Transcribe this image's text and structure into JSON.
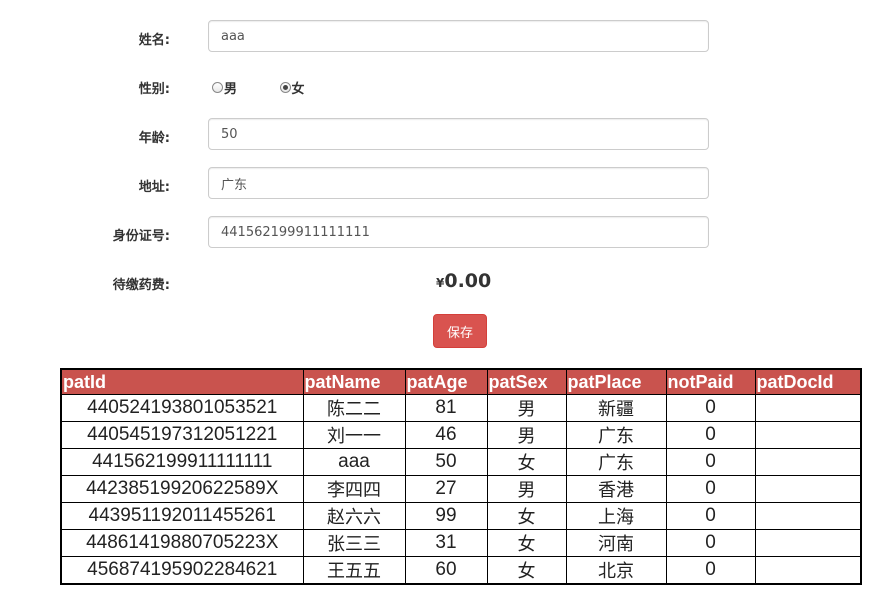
{
  "form": {
    "name_label": "姓名:",
    "name_value": "aaa",
    "sex_label": "性别:",
    "sex_options": [
      {
        "label": "男",
        "checked": false
      },
      {
        "label": "女",
        "checked": true
      }
    ],
    "age_label": "年龄:",
    "age_value": "50",
    "address_label": "地址:",
    "address_value": "广东",
    "idcard_label": "身份证号:",
    "idcard_value": "441562199911111111",
    "fee_label": "待缴药费:",
    "fee_currency": "¥",
    "fee_amount": "0.00",
    "save_label": "保存"
  },
  "table": {
    "header_color": "#c9534e",
    "columns": [
      "patId",
      "patName",
      "patAge",
      "patSex",
      "patPlace",
      "notPaid",
      "patDocId"
    ],
    "rows": [
      [
        "440524193801053521",
        "陈二二",
        "81",
        "男",
        "新疆",
        "0",
        ""
      ],
      [
        "440545197312051221",
        "刘一一",
        "46",
        "男",
        "广东",
        "0",
        ""
      ],
      [
        "441562199911111111",
        "aaa",
        "50",
        "女",
        "广东",
        "0",
        ""
      ],
      [
        "44238519920622589X",
        "李四四",
        "27",
        "男",
        "香港",
        "0",
        ""
      ],
      [
        "443951192011455261",
        "赵六六",
        "99",
        "女",
        "上海",
        "0",
        ""
      ],
      [
        "44861419880705223X",
        "张三三",
        "31",
        "女",
        "河南",
        "0",
        ""
      ],
      [
        "456874195902284621",
        "王五五",
        "60",
        "女",
        "北京",
        "0",
        ""
      ]
    ]
  }
}
